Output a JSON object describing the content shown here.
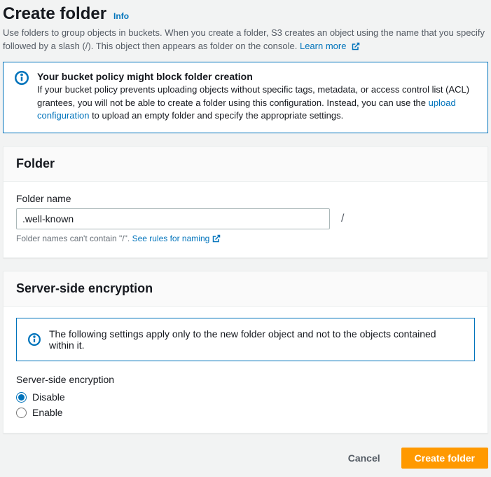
{
  "header": {
    "title": "Create folder",
    "info": "Info"
  },
  "intro": {
    "text": "Use folders to group objects in buckets. When you create a folder, S3 creates an object using the name that you specify followed by a slash (/). This object then appears as folder on the console.",
    "learn_more": "Learn more"
  },
  "policy_alert": {
    "title": "Your bucket policy might block folder creation",
    "body_before": "If your bucket policy prevents uploading objects without specific tags, metadata, or access control list (ACL) grantees, you will not be able to create a folder using this configuration. Instead, you can use the ",
    "link": "upload configuration",
    "body_after": " to upload an empty folder and specify the appropriate settings."
  },
  "folder_panel": {
    "title": "Folder",
    "label": "Folder name",
    "value": ".well-known",
    "suffix": "/",
    "hint_before": "Folder names can't contain \"/\". ",
    "hint_link": "See rules for naming"
  },
  "sse_panel": {
    "title": "Server-side encryption",
    "notice": "The following settings apply only to the new folder object and not to the objects contained within it.",
    "group_label": "Server-side encryption",
    "options": {
      "disable": "Disable",
      "enable": "Enable"
    },
    "selected": "disable"
  },
  "footer": {
    "cancel": "Cancel",
    "submit": "Create folder"
  }
}
